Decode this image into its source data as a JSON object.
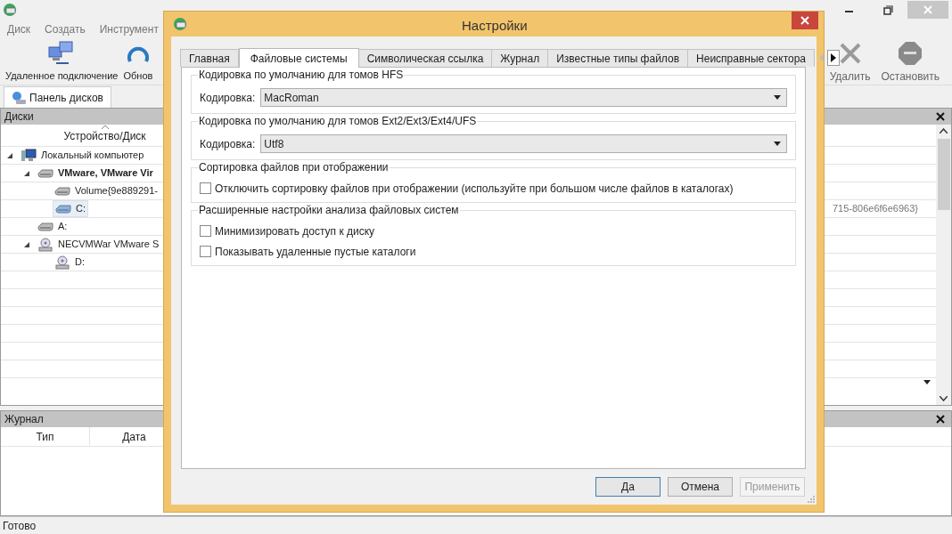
{
  "app": {
    "menu": [
      "Диск",
      "Создать",
      "Инструмент"
    ],
    "toolbar_left": [
      {
        "label": "Удаленное подключение",
        "kind": "network"
      },
      {
        "label": "Обнов",
        "kind": "refresh"
      }
    ],
    "toolbar_right": [
      {
        "label": "Удалить",
        "kind": "delete"
      },
      {
        "label": "Остановить",
        "kind": "stop"
      }
    ],
    "tabs": [
      {
        "label": "Панель дисков",
        "selected": true
      }
    ],
    "disks_panel": {
      "title": "Диски",
      "column": "Устройство/Диск",
      "tree": [
        {
          "label": "Локальный компьютер",
          "kind": "computer",
          "selected": false,
          "expanded": true,
          "children": [
            {
              "label": "VMware, VMware Vir",
              "kind": "disk",
              "selected": false,
              "expanded": true,
              "children": [
                {
                  "label": "Volume{9e889291-",
                  "kind": "disk",
                  "selected": false
                },
                {
                  "label": "C:",
                  "kind": "volume",
                  "selected": true,
                  "detail": "715-806e6f6e6963}"
                }
              ]
            },
            {
              "label": "A:",
              "kind": "disk",
              "selected": false
            },
            {
              "label": "NECVMWar VMware S",
              "kind": "cdrom",
              "selected": false,
              "expanded": true,
              "children": [
                {
                  "label": "D:",
                  "kind": "cdrom",
                  "selected": false
                }
              ]
            }
          ]
        }
      ]
    },
    "log_panel": {
      "title": "Журнал",
      "columns": [
        "Тип",
        "Дата"
      ]
    },
    "status_bar": "Готово"
  },
  "dialog": {
    "title": "Настройки",
    "tabs": [
      {
        "label": "Главная",
        "selected": false
      },
      {
        "label": "Файловые системы",
        "selected": true
      },
      {
        "label": "Символическая ссылка",
        "selected": false
      },
      {
        "label": "Журнал",
        "selected": false
      },
      {
        "label": "Известные типы файлов",
        "selected": false
      },
      {
        "label": "Неисправные сектора",
        "selected": false
      }
    ],
    "groups": [
      {
        "title": "Кодировка по умолчанию для томов HFS",
        "kind": "select",
        "label": "Кодировка:",
        "value": "MacRoman"
      },
      {
        "title": "Кодировка по умолчанию для томов Ext2/Ext3/Ext4/UFS",
        "kind": "select",
        "label": "Кодировка:",
        "value": "Utf8"
      },
      {
        "title": "Сортировка файлов при отображении",
        "kind": "checkboxes",
        "items": [
          {
            "label": "Отключить сортировку файлов при отображении (используйте при большом числе файлов в каталогах)",
            "checked": false
          }
        ]
      },
      {
        "title": "Расширенные настройки анализа файловых систем",
        "kind": "checkboxes",
        "items": [
          {
            "label": "Минимизировать доступ к диску",
            "checked": false
          },
          {
            "label": "Показывать удаленные пустые каталоги",
            "checked": false
          }
        ]
      }
    ],
    "buttons": [
      {
        "label": "Да",
        "default": true,
        "disabled": false
      },
      {
        "label": "Отмена",
        "default": false,
        "disabled": false
      },
      {
        "label": "Применить",
        "default": false,
        "disabled": true
      }
    ]
  }
}
